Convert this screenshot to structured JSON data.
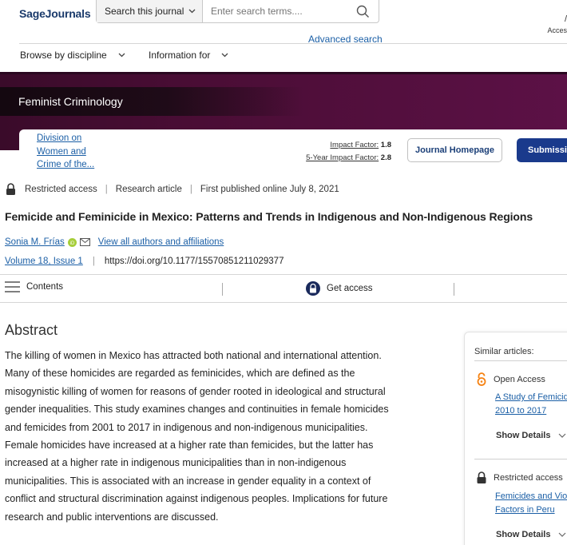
{
  "header": {
    "logo": "Sage",
    "logo_suffix": "Journals",
    "search_scope": "Search this journal",
    "search_placeholder": "Enter search terms....",
    "advanced_search": "Advanced search",
    "access_label": "Acces",
    "nav": [
      {
        "label": "Browse by discipline"
      },
      {
        "label": "Information for"
      }
    ]
  },
  "banner": {
    "journal_title": "Feminist Criminology",
    "society": "Division on Women and Crime of the...",
    "impact_factor_label": "Impact Factor:",
    "impact_factor_value": "1.8",
    "five_year_label": "5-Year Impact Factor:",
    "five_year_value": "2.8",
    "journal_homepage": "Journal Homepage",
    "submission": "Submission"
  },
  "article": {
    "access": "Restricted access",
    "type": "Research article",
    "published": "First published online July 8, 2021",
    "title": "Femicide and Feminicide in Mexico: Patterns and Trends in Indigenous and Non-Indigenous Regions",
    "author": "Sonia M. Frías",
    "view_authors": "View all authors and affiliations",
    "volume": "Volume 18, Issue 1",
    "doi": "https://doi.org/10.1177/15570851211029377"
  },
  "toolbar": {
    "contents": "Contents",
    "get_access": "Get access"
  },
  "abstract": {
    "heading": "Abstract",
    "text": "The killing of women in Mexico has attracted both national and international attention. Many of these homicides are regarded as feminicides, which are defined as the misogynistic killing of women for reasons of gender rooted in ideological and structural gender inequalities. This study examines changes and continuities in female homicides and femicides from 2001 to 2017 in indigenous and non-indigenous municipalities. Female homicides have increased at a higher rate than femicides, but the latter has increased at a higher rate in indigenous municipalities than in non-indigenous municipalities. This is associated with an increase in gender equality in a context of conflict and structural discrimination against indigenous peoples. Implications for future research and public interventions are discussed."
  },
  "sidebar": {
    "heading": "Similar articles:",
    "items": [
      {
        "access": "Open Access",
        "title_line1": "A Study of Femicide",
        "title_line2": "2010 to 2017",
        "details": "Show Details"
      },
      {
        "access": "Restricted access",
        "title_line1": "Femicides and Vio",
        "title_line2": "Factors in Peru",
        "details": "Show Details"
      }
    ]
  },
  "colors": {
    "banner": "#4a0d35",
    "link": "#1b5fa6",
    "submission_button": "#1a3a8c",
    "orcid": "#a6ce39",
    "open_access": "#f68212"
  }
}
